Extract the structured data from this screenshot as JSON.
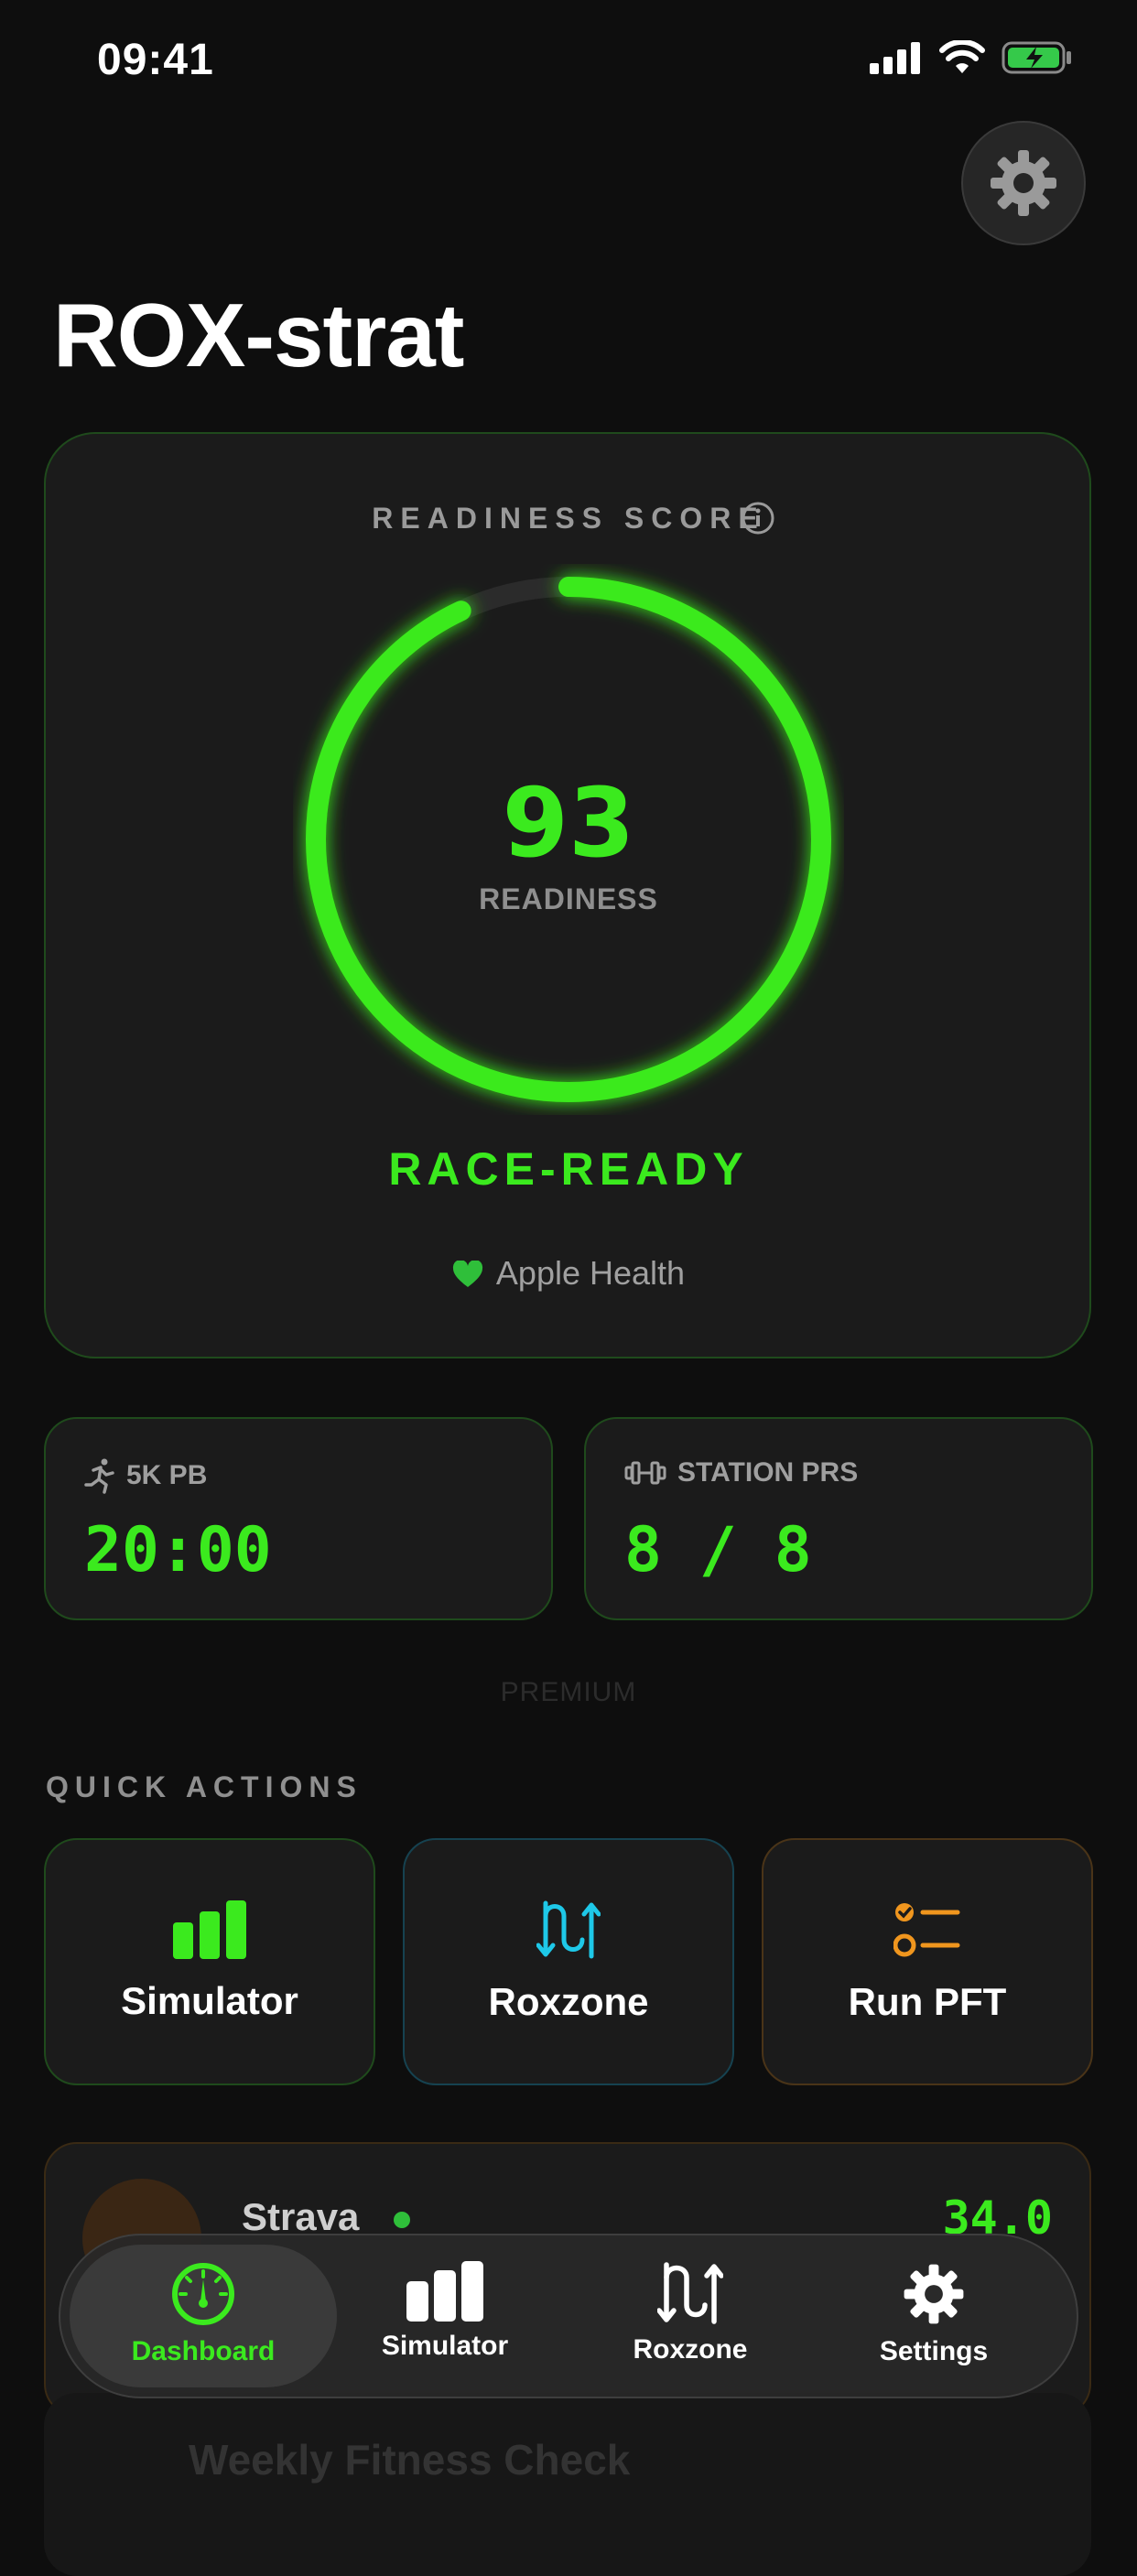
{
  "status_bar": {
    "time": "09:41"
  },
  "header": {
    "title": "ROX-strat",
    "settings_icon": "gear-icon"
  },
  "readiness": {
    "label": "READINESS SCORE",
    "score": "93",
    "score_value": 93,
    "score_sub": "READINESS",
    "status": "RACE-READY",
    "source": "Apple Health",
    "accent": "#3bea1e"
  },
  "stats": [
    {
      "label": "5K PB",
      "value": "20:00",
      "icon": "runner-icon"
    },
    {
      "label": "STATION PRS",
      "value": "8 / 8",
      "icon": "dumbbell-icon"
    }
  ],
  "premium_label": "PREMIUM",
  "quick_actions": {
    "label": "QUICK ACTIONS",
    "items": [
      {
        "label": "Simulator",
        "icon": "bar-chart-icon",
        "color": "#3bea1e"
      },
      {
        "label": "Roxzone",
        "icon": "arrows-updown-icon",
        "color": "#1ec8e8"
      },
      {
        "label": "Run PFT",
        "icon": "checklist-icon",
        "color": "#f0961e"
      }
    ]
  },
  "strava": {
    "name": "Strava",
    "value": "34.0"
  },
  "weekly": {
    "title": "Weekly Fitness Check"
  },
  "tabbar": {
    "items": [
      {
        "label": "Dashboard",
        "icon": "gauge-icon"
      },
      {
        "label": "Simulator",
        "icon": "bar-chart-icon"
      },
      {
        "label": "Roxzone",
        "icon": "arrows-updown-icon"
      },
      {
        "label": "Settings",
        "icon": "gear-icon"
      }
    ],
    "active": "Dashboard"
  }
}
